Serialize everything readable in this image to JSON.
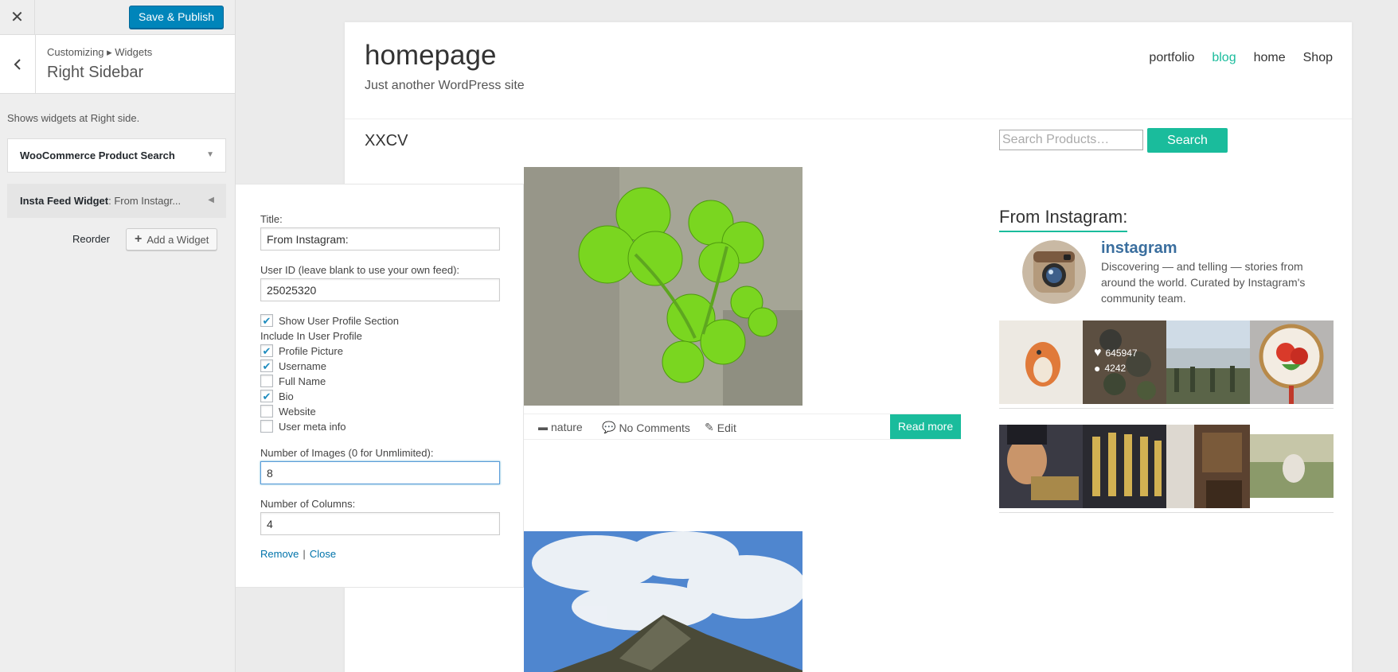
{
  "customizer": {
    "close_icon": "close-icon",
    "publish_label": "Save & Publish",
    "breadcrumb": "Customizing ▸ Widgets",
    "section_title": "Right Sidebar",
    "section_description": "Shows widgets at Right side.",
    "widgets": [
      {
        "title": "WooCommerce Product Search",
        "in_title": ""
      },
      {
        "title": "Insta Feed Widget",
        "in_title": ": From Instagr..."
      }
    ],
    "reorder_label": "Reorder",
    "add_widget_label": "Add a Widget"
  },
  "widget_form": {
    "title_label": "Title:",
    "title_value": "From Instagram:",
    "userid_label": "User ID (leave blank to use your own feed):",
    "userid_value": "25025320",
    "show_profile_label": "Show User Profile Section",
    "show_profile_checked": true,
    "include_label": "Include In User Profile",
    "include_options": [
      {
        "label": "Profile Picture",
        "checked": true
      },
      {
        "label": "Username",
        "checked": true
      },
      {
        "label": "Full Name",
        "checked": false
      },
      {
        "label": "Bio",
        "checked": true
      },
      {
        "label": "Website",
        "checked": false
      },
      {
        "label": "User meta info",
        "checked": false
      }
    ],
    "images_label": "Number of Images (0 for Unmlimited):",
    "images_value": "8",
    "columns_label": "Number of Columns:",
    "columns_value": "4",
    "remove_label": "Remove",
    "close_label": "Close"
  },
  "site": {
    "title": "homepage",
    "tagline": "Just another WordPress site",
    "nav": [
      "portfolio",
      "blog",
      "home",
      "Shop"
    ],
    "active_nav": "blog",
    "accent_color": "#1abc9c",
    "post_title": "XXCV",
    "search_placeholder": "Search Products…",
    "search_button": "Search",
    "post_meta": {
      "category": "nature",
      "comments": "No Comments",
      "edit": "Edit",
      "read_more": "Read more"
    }
  },
  "instagram": {
    "widget_title": "From Instagram:",
    "username": "instagram",
    "bio": "Discovering — and telling — stories from around the world. Curated by Instagram's community team.",
    "hover_likes": "645947",
    "hover_comments": "4242"
  }
}
